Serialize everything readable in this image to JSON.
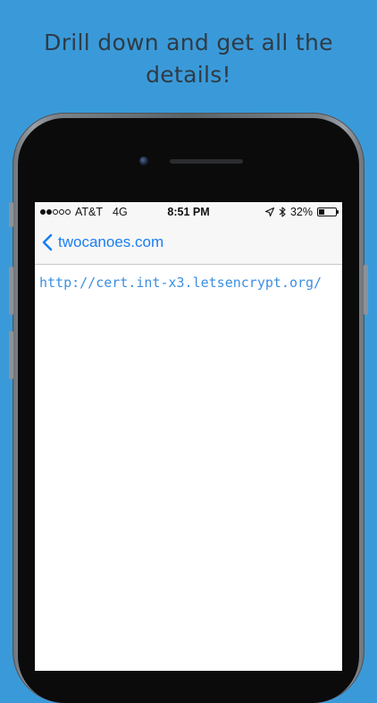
{
  "headline": {
    "line1": "Drill down and get all the",
    "line2": "details!"
  },
  "status_bar": {
    "signal_dots_filled": 2,
    "signal_dots_total": 5,
    "carrier": "AT&T",
    "network": "4G",
    "time": "8:51 PM",
    "battery_percent": "32%",
    "battery_level": 0.32
  },
  "nav": {
    "back_label": "twocanoes.com",
    "accent_color": "#1a7ef2"
  },
  "content": {
    "url": "http://cert.int-x3.letsencrypt.org/",
    "link_color": "#3d8fe0"
  },
  "background_color": "#3a9ad9"
}
